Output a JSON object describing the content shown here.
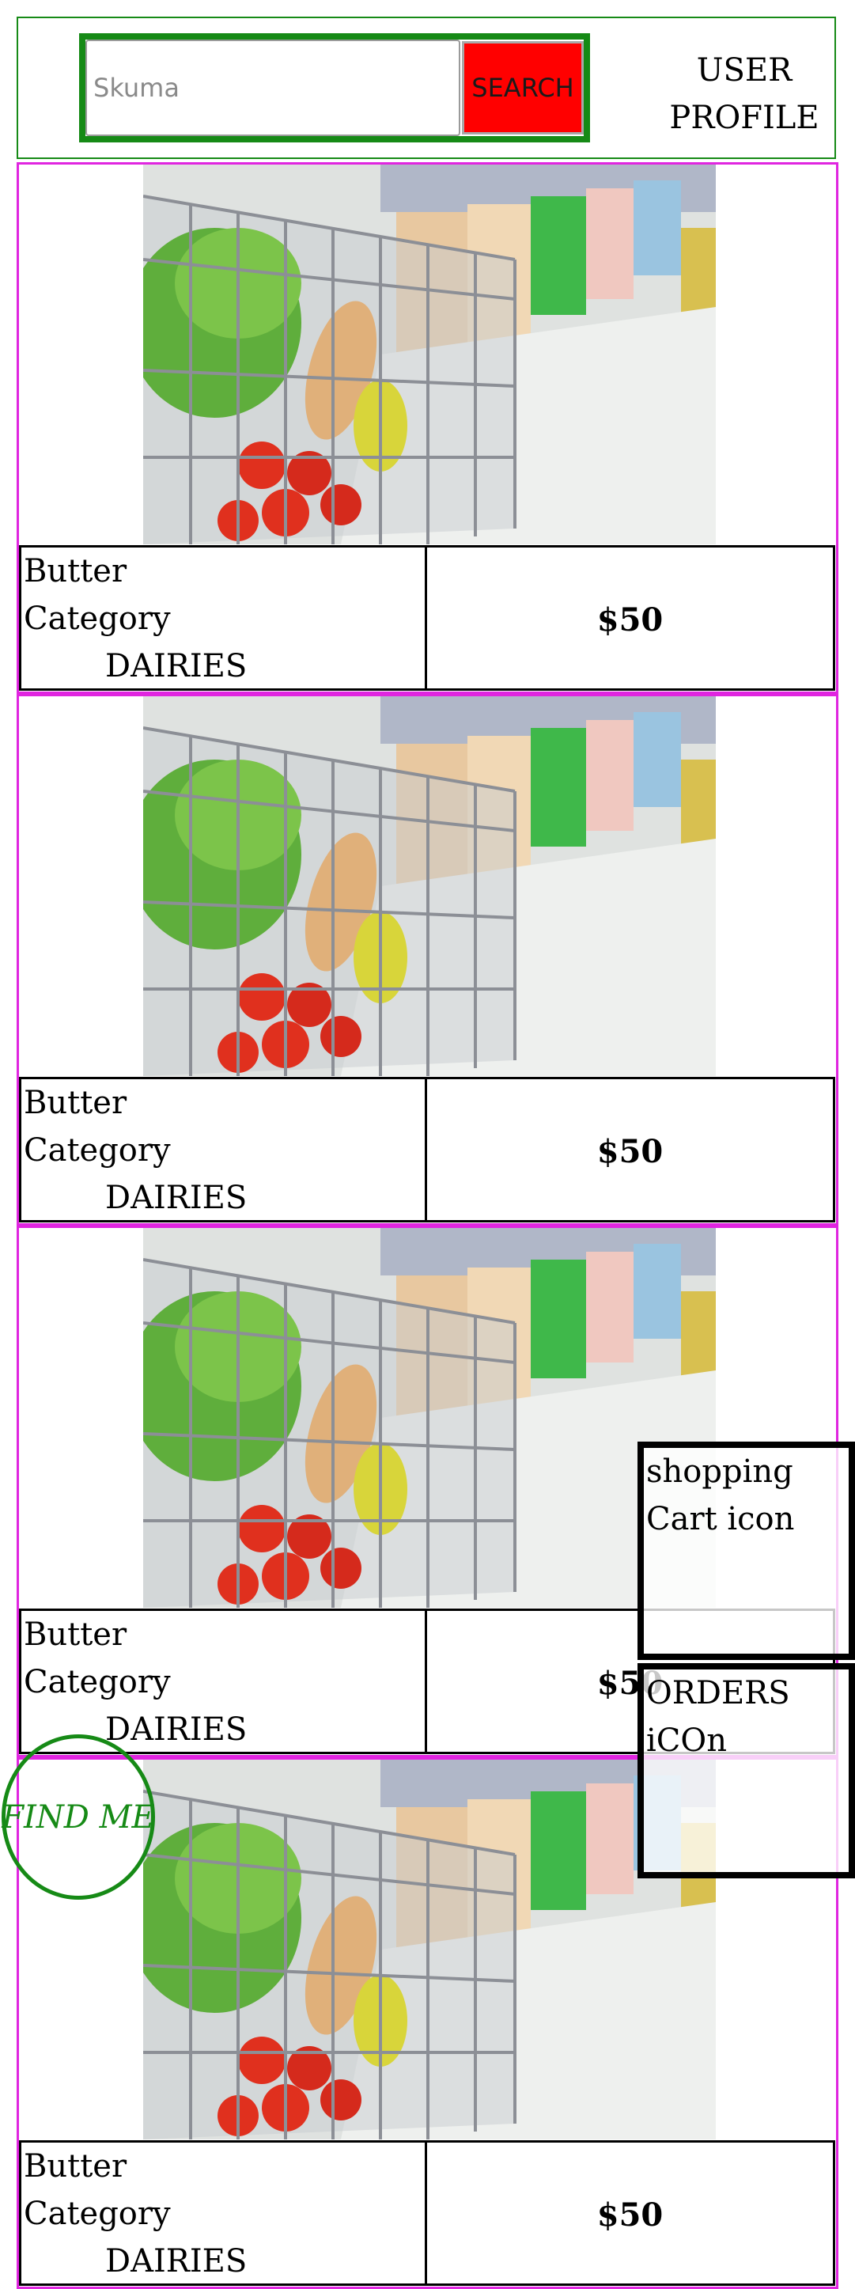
{
  "header": {
    "search": {
      "placeholder": "Skuma",
      "button_label": "SEARCH"
    },
    "user_profile": [
      "USER",
      "PROFILE"
    ]
  },
  "products": [
    {
      "name": "Butter",
      "category_label": "Category",
      "category": "DAIRIES",
      "price": "$50"
    },
    {
      "name": "Butter",
      "category_label": "Category",
      "category": "DAIRIES",
      "price": "$50"
    },
    {
      "name": "Butter",
      "category_label": "Category",
      "category": "DAIRIES",
      "price": "$50"
    },
    {
      "name": "Butter",
      "category_label": "Category",
      "category": "DAIRIES",
      "price": "$50"
    }
  ],
  "floating": {
    "cart": [
      "shopping",
      "Cart icon"
    ],
    "orders": [
      "ORDERS",
      "iCOn"
    ],
    "find_me": "FIND ME"
  },
  "colors": {
    "header_border": "#168a16",
    "search_button": "#ff0000",
    "card_border": "#e025e0",
    "find_me": "#168a16"
  }
}
